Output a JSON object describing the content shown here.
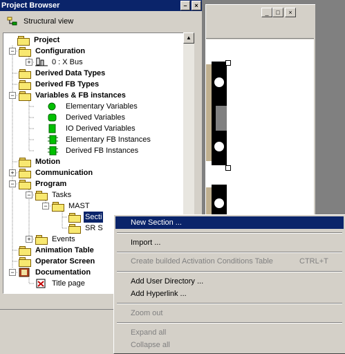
{
  "browser": {
    "title": "Project Browser",
    "view_button": "Structural view",
    "pin_glyph": "–",
    "close_glyph": "×"
  },
  "tree": {
    "project": "Project",
    "configuration": "Configuration",
    "bus": "0 : X Bus",
    "derived_data_types": "Derived Data Types",
    "derived_fb_types": "Derived FB Types",
    "variables": "Variables & FB instances",
    "elementary_vars": "Elementary Variables",
    "derived_vars": "Derived Variables",
    "io_derived_vars": "IO Derived Variables",
    "elementary_fb": "Elementary FB Instances",
    "derived_fb": "Derived FB Instances",
    "motion": "Motion",
    "communication": "Communication",
    "program": "Program",
    "tasks": "Tasks",
    "mast": "MAST",
    "sections": "Secti",
    "sr_sections": "SR S",
    "events": "Events",
    "animation_tables": "Animation Table",
    "operator_screens": "Operator Screen",
    "documentation": "Documentation",
    "title_page": "Title page"
  },
  "window_buttons": {
    "min": "_",
    "max": "□",
    "close": "×"
  },
  "context_menu": {
    "new_section": "New Section ...",
    "import": "Import ...",
    "create_table": "Create builded Activation Conditions Table",
    "create_table_shortcut": "CTRL+T",
    "add_user_directory": "Add User Directory ...",
    "add_hyperlink": "Add Hyperlink ...",
    "zoom_out": "Zoom out",
    "expand_all": "Expand all",
    "collapse_all": "Collapse all"
  },
  "colors": {
    "selection": "#0a246a",
    "green_icon": "#00c000",
    "folder": "#f8e870"
  }
}
